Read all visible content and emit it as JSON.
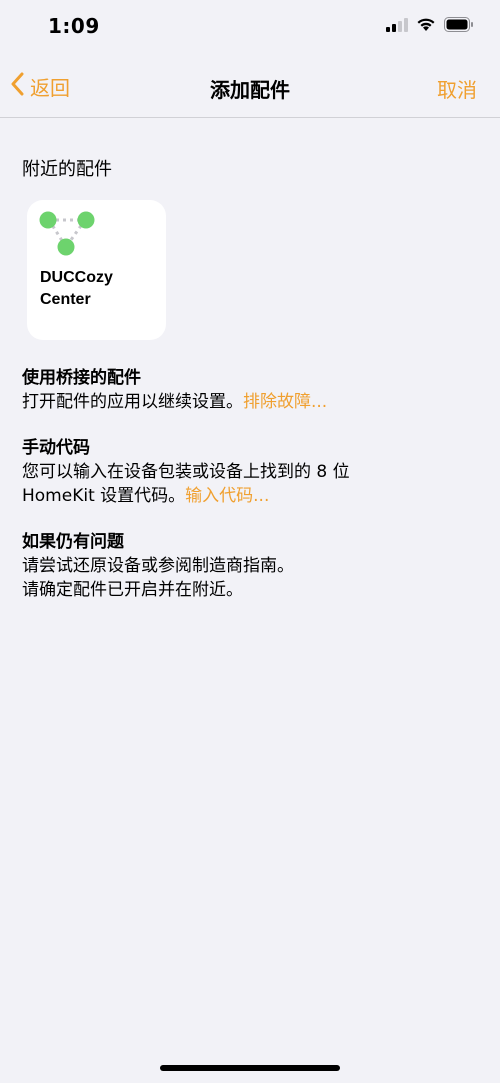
{
  "status_bar": {
    "time": "1:09"
  },
  "nav": {
    "back_label": "返回",
    "title": "添加配件",
    "cancel_label": "取消"
  },
  "nearby": {
    "header": "附近的配件",
    "accessory_name": "DUCCozy\nCenter"
  },
  "bridge": {
    "title": "使用桥接的配件",
    "text": "打开配件的应用以继续设置。",
    "link": "排除故障..."
  },
  "manual_code": {
    "title": "手动代码",
    "text_line1": "您可以输入在设备包装或设备上找到的 8 位",
    "text_line2": "HomeKit 设置代码。",
    "link": "输入代码..."
  },
  "still_problem": {
    "title": "如果仍有问题",
    "line1": "请尝试还原设备或参阅制造商指南。",
    "line2": "请确定配件已开启并在附近。"
  },
  "colors": {
    "accent": "#f0a030",
    "background": "#f2f2f7",
    "accessory_dot": "#6dd36d"
  },
  "icons": [
    "signal-icon",
    "wifi-icon",
    "battery-icon",
    "chevron-left-icon",
    "accessory-bridge-icon"
  ]
}
